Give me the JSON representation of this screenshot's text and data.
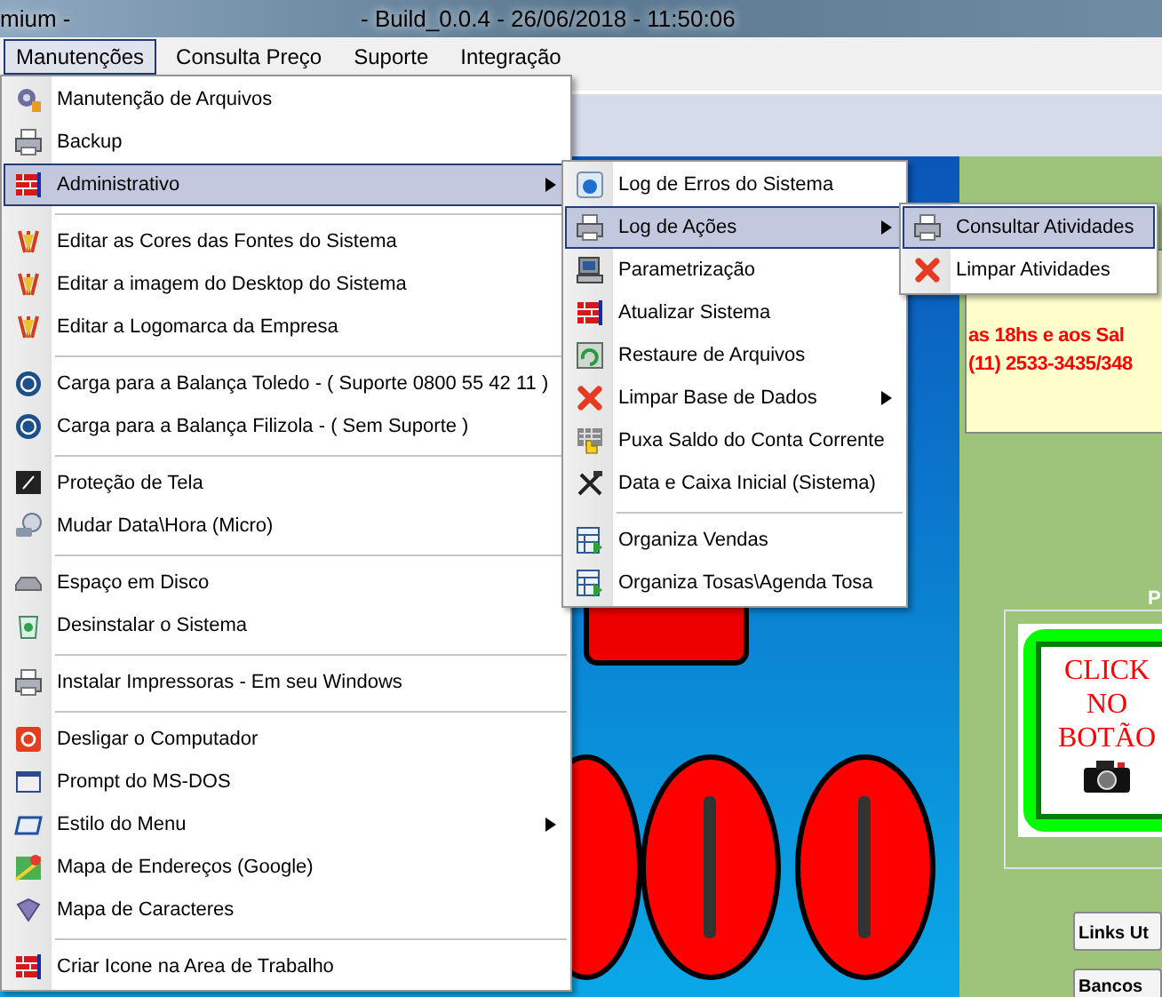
{
  "title_bar": {
    "left_text": "mium -",
    "right_text": "- Build_0.0.4 - 26/06/2018 - 11:50:06"
  },
  "menu_bar": [
    {
      "label": "Manutenções",
      "selected": true
    },
    {
      "label": "Consulta Preço",
      "selected": false
    },
    {
      "label": "Suporte",
      "selected": false
    },
    {
      "label": "Integração",
      "selected": false
    }
  ],
  "menu": {
    "items": [
      {
        "kind": "item",
        "label": "Manutenção de Arquivos",
        "selected": false,
        "has_submenu": false
      },
      {
        "kind": "item",
        "label": "Backup",
        "selected": false,
        "has_submenu": false
      },
      {
        "kind": "item",
        "label": "Administrativo",
        "selected": true,
        "has_submenu": true
      },
      {
        "kind": "separator"
      },
      {
        "kind": "item",
        "label": "Editar as Cores das Fontes do Sistema",
        "selected": false,
        "has_submenu": false
      },
      {
        "kind": "item",
        "label": "Editar a imagem do Desktop do Sistema",
        "selected": false,
        "has_submenu": false
      },
      {
        "kind": "item",
        "label": "Editar a Logomarca da Empresa",
        "selected": false,
        "has_submenu": false
      },
      {
        "kind": "separator"
      },
      {
        "kind": "item",
        "label": "Carga para a Balança Toledo - ( Suporte 0800 55 42 11 )",
        "selected": false,
        "has_submenu": false
      },
      {
        "kind": "item",
        "label": "Carga para a Balança Filizola - ( Sem Suporte )",
        "selected": false,
        "has_submenu": false
      },
      {
        "kind": "separator"
      },
      {
        "kind": "item",
        "label": "Proteção de Tela",
        "selected": false,
        "has_submenu": false
      },
      {
        "kind": "item",
        "label": "Mudar Data\\Hora (Micro)",
        "selected": false,
        "has_submenu": false
      },
      {
        "kind": "separator"
      },
      {
        "kind": "item",
        "label": "Espaço em Disco",
        "selected": false,
        "has_submenu": false
      },
      {
        "kind": "item",
        "label": "Desinstalar o Sistema",
        "selected": false,
        "has_submenu": false
      },
      {
        "kind": "separator"
      },
      {
        "kind": "item",
        "label": "Instalar Impressoras - Em seu Windows",
        "selected": false,
        "has_submenu": false
      },
      {
        "kind": "separator"
      },
      {
        "kind": "item",
        "label": "Desligar o Computador",
        "selected": false,
        "has_submenu": false
      },
      {
        "kind": "item",
        "label": "Prompt do MS-DOS",
        "selected": false,
        "has_submenu": false
      },
      {
        "kind": "item",
        "label": "Estilo do Menu",
        "selected": false,
        "has_submenu": true
      },
      {
        "kind": "item",
        "label": "Mapa de Endereços (Google)",
        "selected": false,
        "has_submenu": false
      },
      {
        "kind": "item",
        "label": "Mapa de Caracteres",
        "selected": false,
        "has_submenu": false
      },
      {
        "kind": "separator"
      },
      {
        "kind": "item",
        "label": "Criar Icone na Area de Trabalho",
        "selected": false,
        "has_submenu": false
      }
    ]
  },
  "submenu": {
    "items": [
      {
        "kind": "item",
        "label": "Log de Erros do Sistema",
        "selected": false,
        "has_submenu": false
      },
      {
        "kind": "item",
        "label": "Log de Ações",
        "selected": true,
        "has_submenu": true
      },
      {
        "kind": "item",
        "label": "Parametrização",
        "selected": false,
        "has_submenu": false
      },
      {
        "kind": "item",
        "label": "Atualizar Sistema",
        "selected": false,
        "has_submenu": false
      },
      {
        "kind": "item",
        "label": "Restaure de Arquivos",
        "selected": false,
        "has_submenu": false
      },
      {
        "kind": "item",
        "label": "Limpar Base de Dados",
        "selected": false,
        "has_submenu": true
      },
      {
        "kind": "item",
        "label": "Puxa Saldo do Conta Corrente",
        "selected": false,
        "has_submenu": false
      },
      {
        "kind": "item",
        "label": "Data e Caixa Inicial (Sistema)",
        "selected": false,
        "has_submenu": false
      },
      {
        "kind": "separator"
      },
      {
        "kind": "item",
        "label": "Organiza Vendas",
        "selected": false,
        "has_submenu": false
      },
      {
        "kind": "item",
        "label": "Organiza Tosas\\Agenda Tosa",
        "selected": false,
        "has_submenu": false
      }
    ]
  },
  "submenu_2": {
    "items": [
      {
        "kind": "item",
        "label": "Consultar Atividades",
        "selected": true,
        "has_submenu": false
      },
      {
        "kind": "item",
        "label": "Limpar Atividades",
        "selected": false,
        "has_submenu": false
      }
    ]
  },
  "notice": {
    "lines": [
      "as 18hs e aos Sal",
      "(11) 2533-3435/348"
    ]
  },
  "panel_label": "P",
  "photo_button": {
    "lines": [
      "CLICK",
      "NO",
      "BOTÃO"
    ]
  },
  "buttons": [
    "Links Ut",
    "Bancos"
  ]
}
